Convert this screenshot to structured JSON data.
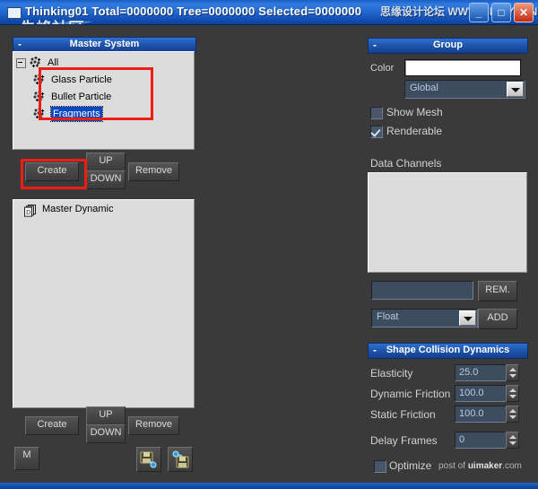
{
  "titlebar": {
    "title": "Thinking01  Total=0000000  Tree=0000000  Selected=0000000",
    "watermark_right": "思缘设计论坛 WWW.MISSYUAN.COM",
    "watermark_left": "朱峰社区",
    "minimize_glyph": "_",
    "maximize_glyph": "□",
    "close_glyph": "✕",
    "icon": "app-window-icon"
  },
  "left_panel": {
    "master_system": {
      "header": "Master System",
      "collapse_glyph": "-",
      "tree": [
        {
          "label": "All",
          "depth": 0,
          "selected": false,
          "expanded": true,
          "icon": "particle-icon"
        },
        {
          "label": "Glass Particle",
          "depth": 1,
          "selected": false,
          "icon": "particle-icon"
        },
        {
          "label": "Bullet Particle",
          "depth": 1,
          "selected": false,
          "icon": "particle-icon"
        },
        {
          "label": "Fragments",
          "depth": 1,
          "selected": true,
          "icon": "particle-icon"
        }
      ],
      "highlight_color": "#ef1c14"
    },
    "buttons_top": {
      "create": "Create",
      "up": "UP",
      "down": "DOWN",
      "remove": "Remove"
    },
    "master_dynamic": {
      "items": [
        {
          "label": "Master Dynamic",
          "icon": "layers-document-icon"
        }
      ]
    },
    "buttons_bottom": {
      "create": "Create",
      "up": "UP",
      "down": "DOWN",
      "remove": "Remove",
      "m": "M",
      "save_icon": "save-out-icon",
      "load_icon": "load-in-icon"
    }
  },
  "right_panel": {
    "group": {
      "header": "Group",
      "collapse_glyph": "-",
      "color_label": "Color",
      "color_value": "#ffffff",
      "mode_value": "Global",
      "show_mesh_label": "Show Mesh",
      "show_mesh_checked": false,
      "renderable_label": "Renderable",
      "renderable_checked": true
    },
    "data_channels": {
      "label": "Data Channels",
      "items": [],
      "name_input_value": "",
      "remove_button": "REM.",
      "type_value": "Float",
      "add_button": "ADD"
    },
    "shape_collision_dynamics": {
      "header": "Shape Collision Dynamics",
      "collapse_glyph": "-",
      "fields": [
        {
          "label": "Elasticity",
          "value": "25.0"
        },
        {
          "label": "Dynamic Friction",
          "value": "100.0"
        },
        {
          "label": "Static Friction",
          "value": "100.0"
        },
        {
          "label": "Delay Frames",
          "value": "0"
        }
      ]
    },
    "optimize": {
      "label": "Optimize",
      "checked": false
    },
    "watermark": "post of uimaker.com"
  },
  "colors": {
    "panel_bg": "#3a3a3a",
    "titlebar_blue": "#1d54ac",
    "list_bg": "#dcdcdc",
    "field_bg": "#3e4c60",
    "selection_blue": "#0a49c4",
    "highlight_red": "#ef1c14"
  }
}
